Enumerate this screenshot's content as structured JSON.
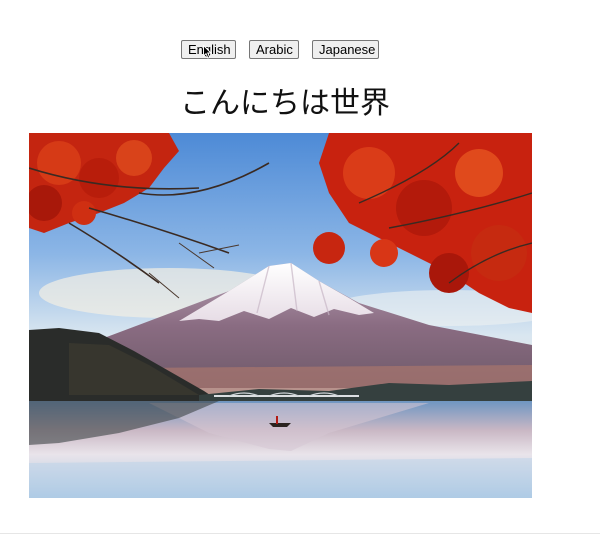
{
  "language_buttons": {
    "english": "English",
    "arabic": "Arabic",
    "japanese": "Japanese"
  },
  "greeting": "こんにちは世界",
  "image": {
    "subject": "mount-fuji-lake-autumn-photo"
  },
  "colors": {
    "sky_top": "#5a93d8",
    "sky_bottom": "#dfe9f1",
    "maple_red": "#c8200f",
    "mountain": "#8b6f86",
    "snow": "#f4f1f3",
    "water": "#9cc0dc"
  }
}
